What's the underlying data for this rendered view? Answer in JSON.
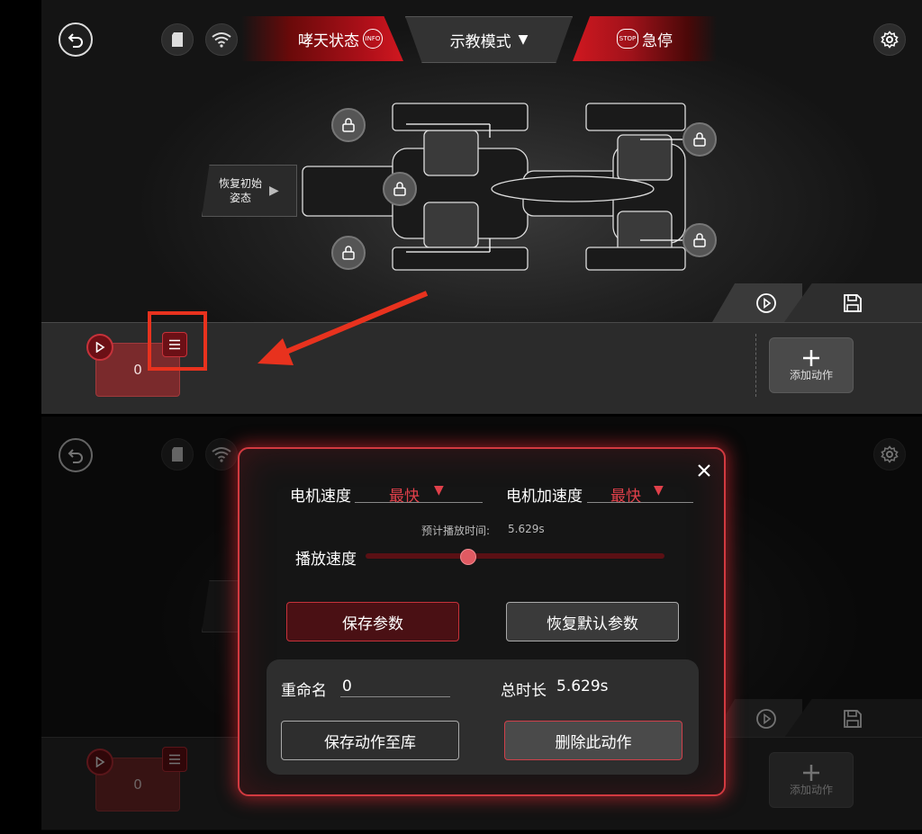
{
  "topbar": {
    "status_label": "哮天状态",
    "info_badge": "INFO",
    "mode_label": "示教模式",
    "estop_label": "急停",
    "stop_badge": "STOP"
  },
  "robot": {
    "restore_label_line1": "恢复初始",
    "restore_label_line2": "姿态"
  },
  "timeline": {
    "action_index": "0",
    "add_action_label": "添加动作"
  },
  "modal": {
    "motor_speed_label": "电机速度",
    "motor_speed_value": "最快",
    "motor_accel_label": "电机加速度",
    "motor_accel_value": "最快",
    "est_time_label": "预计播放时间:",
    "est_time_value": "5.629s",
    "play_speed_label": "播放速度",
    "play_speed_fraction": 0.34,
    "save_params_label": "保存参数",
    "restore_default_label": "恢复默认参数",
    "rename_label": "重命名",
    "rename_value": "0",
    "total_duration_label": "总时长",
    "total_duration_value": "5.629s",
    "save_to_library_label": "保存动作至库",
    "delete_action_label": "删除此动作"
  },
  "colors": {
    "accent_red": "#d01820",
    "highlight_box": "#e8321e",
    "arrow": "#e8321e"
  },
  "icons": [
    "back-icon",
    "sd-card-icon",
    "wifi-icon",
    "info-icon",
    "caret-down-icon",
    "stop-icon",
    "settings-icon",
    "lock-icon",
    "play-icon",
    "save-icon",
    "menu-icon",
    "plus-icon",
    "close-icon"
  ]
}
